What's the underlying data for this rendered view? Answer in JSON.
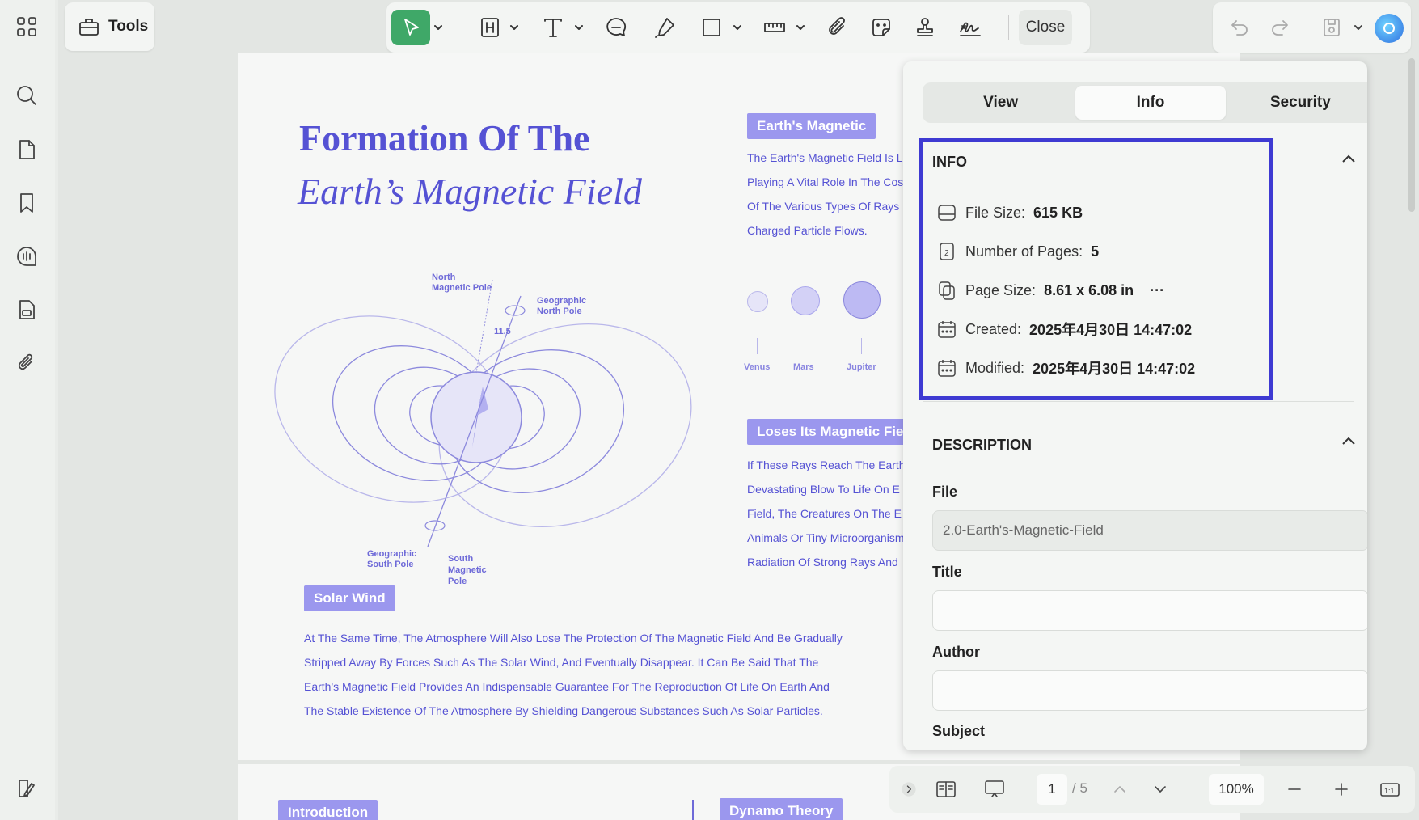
{
  "toolbar": {
    "tools_label": "Tools",
    "close_label": "Close"
  },
  "document": {
    "title_line1": "Formation Of The",
    "title_line2": "Earth’s Magnetic Field",
    "tag_magnetic": "Earth's Magnetic",
    "para_magnetic": [
      "The Earth's Magnetic Field Is L",
      "Playing A Vital Role In The Cos",
      "Of The Various Types Of Rays",
      "Charged Particle Flows."
    ],
    "planets": [
      "Venus",
      "Mars",
      "Jupiter"
    ],
    "tag_loses": "Loses Its Magnetic Field",
    "para_loses": [
      "If These Rays Reach The Earth",
      "Devastating Blow To Life On E",
      "Field, The Creatures On The E",
      "Animals Or Tiny Microorganism",
      "Radiation Of Strong Rays And"
    ],
    "tag_solar": "Solar Wind",
    "para_solar": [
      "At The Same Time, The Atmosphere Will Also Lose The Protection Of The Magnetic Field And Be Gradually",
      "Stripped Away By Forces Such As The Solar Wind, And Eventually Disappear. It Can Be Said That The",
      "Earth's Magnetic Field Provides An Indispensable Guarantee For The Reproduction Of Life On Earth And",
      "The Stable Existence Of The Atmosphere By Shielding Dangerous Substances Such As Solar Particles."
    ],
    "diagram_labels": {
      "north_mag_1": "North",
      "north_mag_2": "Magnetic Pole",
      "geo_north_1": "Geographic",
      "geo_north_2": "North Pole",
      "geo_south_1": "Geographic",
      "geo_south_2": "South Pole",
      "south_mag_1": "South",
      "south_mag_2": "Magnetic",
      "south_mag_3": "Pole",
      "angle": "11.5"
    },
    "tag_intro": "Introduction",
    "tag_dynamo": "Dynamo Theory"
  },
  "panel": {
    "tabs": [
      "View",
      "Info",
      "Security"
    ],
    "info_title": "INFO",
    "info": [
      {
        "label": "File Size:",
        "value": "615 KB",
        "icon": "drive-icon"
      },
      {
        "label": "Number of Pages:",
        "value": "5",
        "icon": "pages-icon"
      },
      {
        "label": "Page Size:",
        "value": "8.61 x 6.08 in",
        "icon": "page-size-icon",
        "more": "···"
      },
      {
        "label": "Created:",
        "value": "2025年4月30日 14:47:02",
        "icon": "calendar-icon"
      },
      {
        "label": "Modified:",
        "value": "2025年4月30日 14:47:02",
        "icon": "calendar-icon"
      }
    ],
    "description_title": "DESCRIPTION",
    "file_label": "File",
    "file_value": "2.0-Earth's-Magnetic-Field",
    "title_label": "Title",
    "title_value": "",
    "author_label": "Author",
    "author_value": "",
    "subject_label": "Subject"
  },
  "bottom": {
    "page_current": "1",
    "page_total": "/ 5",
    "zoom": "100%"
  }
}
